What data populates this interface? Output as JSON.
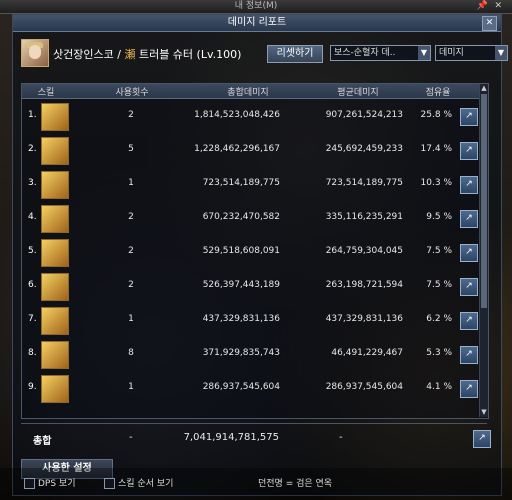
{
  "top_bar": {
    "title": "내 정보(M)",
    "pin": "📌",
    "close": "✕"
  },
  "window": {
    "title": "데미지 리포트",
    "close": "✕"
  },
  "character": {
    "name": "삿건장인스코",
    "separator": "/",
    "job_icon": "瀬",
    "job": "트러블 슈터 (Lv.100)"
  },
  "controls": {
    "reset_label": "리셋하기",
    "boss_select": "보스-순혈자 데..",
    "metric_select": "데미지",
    "arrow": "▼"
  },
  "headers": {
    "skill": "스킬",
    "uses": "사용횟수",
    "total": "총합데미지",
    "avg": "평균데미지",
    "share": "점유율"
  },
  "rows": [
    {
      "rank": "1.",
      "uses": "2",
      "total": "1,814,523,048,426",
      "avg": "907,261,524,213",
      "share": "25.8 %"
    },
    {
      "rank": "2.",
      "uses": "5",
      "total": "1,228,462,296,167",
      "avg": "245,692,459,233",
      "share": "17.4 %"
    },
    {
      "rank": "3.",
      "uses": "1",
      "total": "723,514,189,775",
      "avg": "723,514,189,775",
      "share": "10.3 %"
    },
    {
      "rank": "4.",
      "uses": "2",
      "total": "670,232,470,582",
      "avg": "335,116,235,291",
      "share": "9.5 %"
    },
    {
      "rank": "5.",
      "uses": "2",
      "total": "529,518,608,091",
      "avg": "264,759,304,045",
      "share": "7.5 %"
    },
    {
      "rank": "6.",
      "uses": "2",
      "total": "526,397,443,189",
      "avg": "263,198,721,594",
      "share": "7.5 %"
    },
    {
      "rank": "7.",
      "uses": "1",
      "total": "437,329,831,136",
      "avg": "437,329,831,136",
      "share": "6.2 %"
    },
    {
      "rank": "8.",
      "uses": "8",
      "total": "371,929,835,743",
      "avg": "46,491,229,467",
      "share": "5.3 %"
    },
    {
      "rank": "9.",
      "uses": "1",
      "total": "286,937,545,604",
      "avg": "286,937,545,604",
      "share": "4.1 %"
    }
  ],
  "total_row": {
    "label": "총합",
    "uses": "-",
    "total": "7,041,914,781,575",
    "avg": "-"
  },
  "settings_label": "사용한 설정",
  "bottom": {
    "dps_label": "DPS 보기",
    "order_label": "스킬 순서 보기",
    "mode_text": "던전명 = 검은 연옥"
  },
  "icons": {
    "export": "export-icon",
    "arrow_up": "▲",
    "arrow_down": "▼",
    "export_glyph": "↗"
  }
}
